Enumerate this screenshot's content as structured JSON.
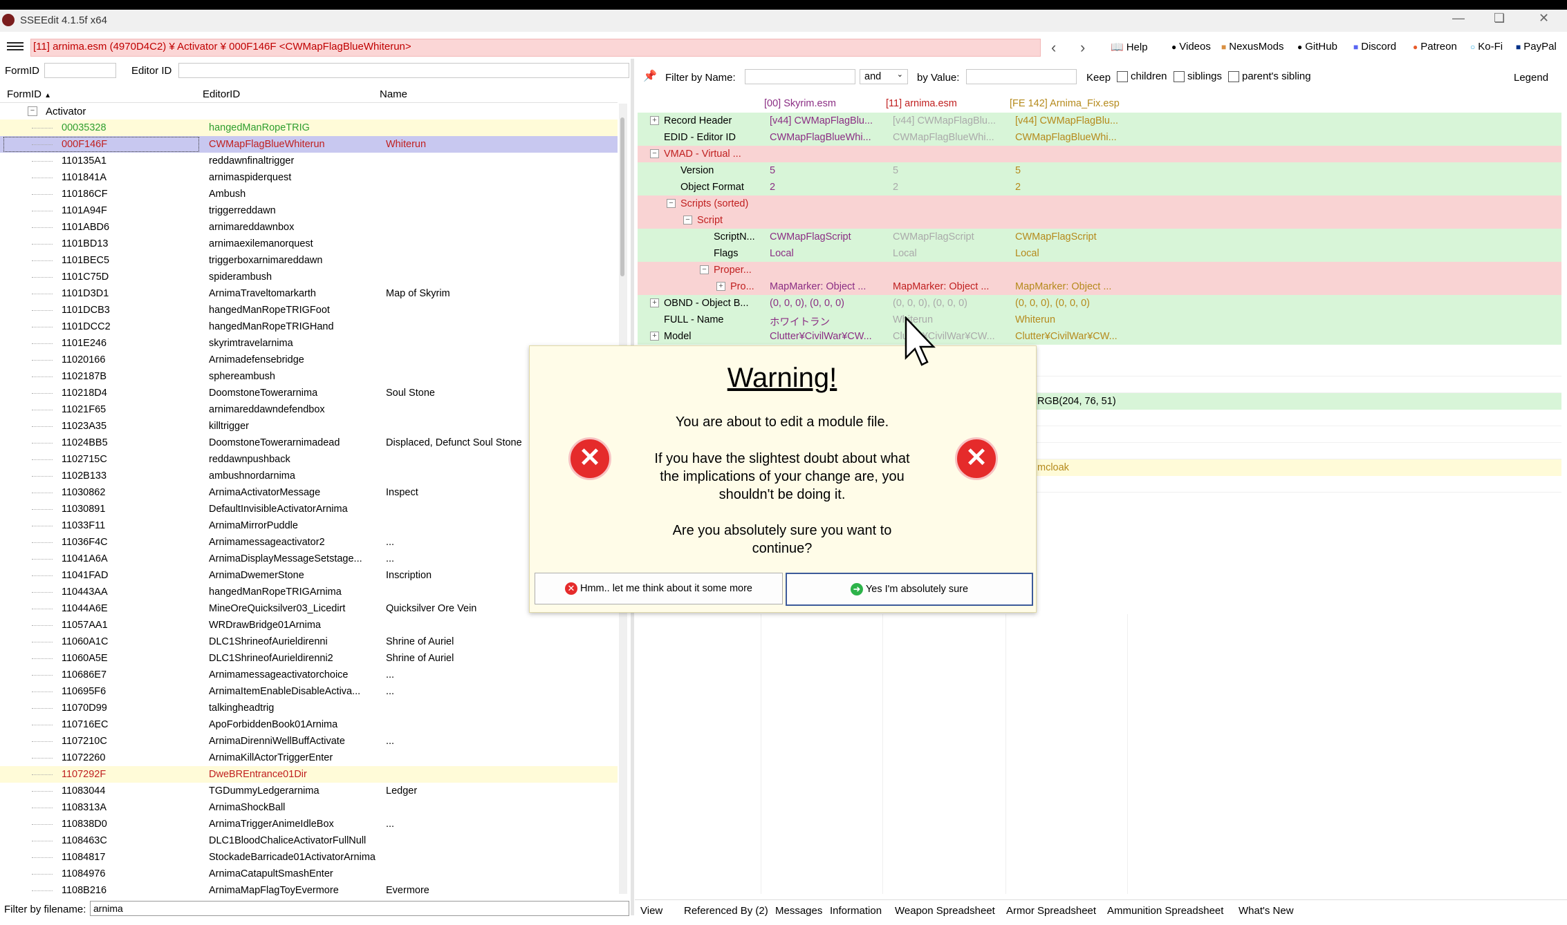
{
  "window": {
    "title": "SSEEdit 4.1.5f x64",
    "path": "[11] arnima.esm (4970D4C2) ¥ Activator ¥ 000F146F <CWMapFlagBlueWhiterun>"
  },
  "toplinks": [
    {
      "label": "Help",
      "icon": "book-icon"
    },
    {
      "label": "Videos",
      "icon": "video-icon"
    },
    {
      "label": "NexusMods",
      "icon": "nexus-icon"
    },
    {
      "label": "GitHub",
      "icon": "github-icon"
    },
    {
      "label": "Discord",
      "icon": "discord-icon"
    },
    {
      "label": "Patreon",
      "icon": "patreon-icon"
    },
    {
      "label": "Ko-Fi",
      "icon": "kofi-icon"
    },
    {
      "label": "PayPal",
      "icon": "paypal-icon"
    }
  ],
  "left": {
    "formid_label": "FormID",
    "editorid_label": "Editor ID",
    "columns": {
      "formid": "FormID",
      "editorid": "EditorID",
      "name": "Name"
    },
    "group": "Activator",
    "rows": [
      {
        "formid": "00035328",
        "editorid": "hangedManRopeTRIG",
        "name": "",
        "style": "green"
      },
      {
        "formid": "000F146F",
        "editorid": "CWMapFlagBlueWhiterun",
        "name": "Whiterun",
        "style": "selected"
      },
      {
        "formid": "110135A1",
        "editorid": "reddawnfinaltrigger",
        "name": ""
      },
      {
        "formid": "1101841A",
        "editorid": "arnimaspiderquest",
        "name": ""
      },
      {
        "formid": "110186CF",
        "editorid": "Ambush",
        "name": ""
      },
      {
        "formid": "1101A94F",
        "editorid": "triggerreddawn",
        "name": ""
      },
      {
        "formid": "1101ABD6",
        "editorid": "arnimareddawnbox",
        "name": ""
      },
      {
        "formid": "1101BD13",
        "editorid": "arnimaexilemanorquest",
        "name": ""
      },
      {
        "formid": "1101BEC5",
        "editorid": "triggerboxarnimareddawn",
        "name": ""
      },
      {
        "formid": "1101C75D",
        "editorid": "spiderambush",
        "name": ""
      },
      {
        "formid": "1101D3D1",
        "editorid": "ArnimaTraveltomarkarth",
        "name": "Map of Skyrim"
      },
      {
        "formid": "1101DCB3",
        "editorid": "hangedManRopeTRIGFoot",
        "name": ""
      },
      {
        "formid": "1101DCC2",
        "editorid": "hangedManRopeTRIGHand",
        "name": ""
      },
      {
        "formid": "1101E246",
        "editorid": "skyrimtravelarnima",
        "name": ""
      },
      {
        "formid": "11020166",
        "editorid": "Arnimadefensebridge",
        "name": ""
      },
      {
        "formid": "1102187B",
        "editorid": "sphereambush",
        "name": ""
      },
      {
        "formid": "110218D4",
        "editorid": "DoomstoneTowerarnima",
        "name": "Soul Stone"
      },
      {
        "formid": "11021F65",
        "editorid": "arnimareddawndefendbox",
        "name": ""
      },
      {
        "formid": "11023A35",
        "editorid": "killtrigger",
        "name": ""
      },
      {
        "formid": "11024BB5",
        "editorid": "DoomstoneTowerarnimadead",
        "name": "Displaced, Defunct Soul Stone"
      },
      {
        "formid": "1102715C",
        "editorid": "reddawnpushback",
        "name": ""
      },
      {
        "formid": "1102B133",
        "editorid": "ambushnordarnima",
        "name": ""
      },
      {
        "formid": "11030862",
        "editorid": "ArnimaActivatorMessage",
        "name": "Inspect"
      },
      {
        "formid": "11030891",
        "editorid": "DefaultInvisibleActivatorArnima",
        "name": ""
      },
      {
        "formid": "11033F11",
        "editorid": "ArnimaMirrorPuddle",
        "name": ""
      },
      {
        "formid": "11036F4C",
        "editorid": "Arnimamessageactivator2",
        "name": "..."
      },
      {
        "formid": "11041A6A",
        "editorid": "ArnimaDisplayMessageSetstage...",
        "name": "..."
      },
      {
        "formid": "11041FAD",
        "editorid": "ArnimaDwemerStone",
        "name": "Inscription"
      },
      {
        "formid": "110443AA",
        "editorid": "hangedManRopeTRIGArnima",
        "name": ""
      },
      {
        "formid": "11044A6E",
        "editorid": "MineOreQuicksilver03_Licedirt",
        "name": "Quicksilver Ore Vein"
      },
      {
        "formid": "11057AA1",
        "editorid": "WRDrawBridge01Arnima",
        "name": ""
      },
      {
        "formid": "11060A1C",
        "editorid": "DLC1ShrineofAurieldirenni",
        "name": "Shrine of Auriel"
      },
      {
        "formid": "11060A5E",
        "editorid": "DLC1ShrineofAurieldirenni2",
        "name": "Shrine of Auriel"
      },
      {
        "formid": "110686E7",
        "editorid": "Arnimamessageactivatorchoice",
        "name": "..."
      },
      {
        "formid": "110695F6",
        "editorid": "ArnimaItemEnableDisableActiva...",
        "name": "..."
      },
      {
        "formid": "11070D99",
        "editorid": "talkingheadtrig",
        "name": ""
      },
      {
        "formid": "110716EC",
        "editorid": "ApoForbiddenBook01Arnima",
        "name": ""
      },
      {
        "formid": "1107210C",
        "editorid": "ArnimaDirenniWellBuffActivate",
        "name": "..."
      },
      {
        "formid": "11072260",
        "editorid": "ArnimaKillActorTriggerEnter",
        "name": ""
      },
      {
        "formid": "1107292F",
        "editorid": "DweBREntrance01Dir",
        "name": "",
        "style": "yellowred"
      },
      {
        "formid": "11083044",
        "editorid": "TGDummyLedgerarnima",
        "name": "Ledger"
      },
      {
        "formid": "1108313A",
        "editorid": "ArnimaShockBall",
        "name": ""
      },
      {
        "formid": "110838D0",
        "editorid": "ArnimaTriggerAnimeIdleBox",
        "name": "..."
      },
      {
        "formid": "1108463C",
        "editorid": "DLC1BloodChaliceActivatorFullNull",
        "name": ""
      },
      {
        "formid": "11084817",
        "editorid": "StockadeBarricade01ActivatorArnima",
        "name": ""
      },
      {
        "formid": "11084976",
        "editorid": "ArnimaCatapultSmashEnter",
        "name": ""
      },
      {
        "formid": "1108B216",
        "editorid": "ArnimaMapFlagToyEvermore",
        "name": "Evermore"
      }
    ],
    "filter_label": "Filter by filename:",
    "filter_value": "arnima"
  },
  "right": {
    "filter_name_label": "Filter by Name:",
    "and_label": "and",
    "filter_value_label": "by Value:",
    "keep_label": "Keep",
    "children_label": "children",
    "siblings_label": "siblings",
    "parents_sibling_label": "parent's sibling",
    "legend_label": "Legend",
    "headers": [
      "[00] Skyrim.esm",
      "[11] arnima.esm",
      "[FE 142] Arnima_Fix.esp"
    ],
    "rows": [
      {
        "label": "Record Header",
        "indent": 0,
        "expander": "+",
        "vals": [
          "[v44] CWMapFlagBlu...",
          "[v44] CWMapFlagBlu...",
          "[v44] CWMapFlagBlu..."
        ],
        "style": "green"
      },
      {
        "label": "EDID - Editor ID",
        "indent": 0,
        "expander": "",
        "vals": [
          "CWMapFlagBlueWhi...",
          "CWMapFlagBlueWhi...",
          "CWMapFlagBlueWhi..."
        ],
        "style": "green"
      },
      {
        "label": "VMAD - Virtual ...",
        "indent": 0,
        "expander": "−",
        "vals": [
          "",
          "",
          ""
        ],
        "style": "red"
      },
      {
        "label": "Version",
        "indent": 1,
        "expander": "",
        "vals": [
          "5",
          "5",
          "5"
        ],
        "style": "green"
      },
      {
        "label": "Object Format",
        "indent": 1,
        "expander": "",
        "vals": [
          "2",
          "2",
          "2"
        ],
        "style": "green"
      },
      {
        "label": "Scripts (sorted)",
        "indent": 1,
        "expander": "−",
        "vals": [
          "",
          "",
          ""
        ],
        "style": "red"
      },
      {
        "label": "Script",
        "indent": 2,
        "expander": "−",
        "vals": [
          "",
          "",
          ""
        ],
        "style": "red"
      },
      {
        "label": "ScriptN...",
        "indent": 3,
        "expander": "",
        "vals": [
          "CWMapFlagScript",
          "CWMapFlagScript",
          "CWMapFlagScript"
        ],
        "style": "green"
      },
      {
        "label": "Flags",
        "indent": 3,
        "expander": "",
        "vals": [
          "Local",
          "Local",
          "Local"
        ],
        "style": "green"
      },
      {
        "label": "Proper...",
        "indent": 3,
        "expander": "−",
        "vals": [
          "",
          "",
          ""
        ],
        "style": "red"
      },
      {
        "label": "Pro...",
        "indent": 4,
        "expander": "+",
        "vals": [
          "MapMarker: Object ...",
          "MapMarker: Object ...",
          "MapMarker: Object ..."
        ],
        "style": "red"
      },
      {
        "label": "OBND - Object B...",
        "indent": 0,
        "expander": "+",
        "vals": [
          "(0, 0, 0), (0, 0, 0)",
          "(0, 0, 0), (0, 0, 0)",
          "(0, 0, 0), (0, 0, 0)"
        ],
        "style": "green"
      },
      {
        "label": "FULL - Name",
        "indent": 0,
        "expander": "",
        "vals": [
          "ホワイトラン",
          "Whiterun",
          "Whiterun"
        ],
        "style": "green"
      },
      {
        "label": "Model",
        "indent": 0,
        "expander": "+",
        "vals": [
          "Clutter¥CivilWar¥CW...",
          "Clutter¥CivilWar¥CW...",
          "Clutter¥CivilWar¥CW..."
        ],
        "style": "green"
      }
    ],
    "partial": {
      "rgb": "RGB(204, 76, 51)",
      "cloak": "mcloak"
    }
  },
  "dialog": {
    "title": "Warning!",
    "line1": "You are about to edit a module file.",
    "line2": "If you have the slightest doubt about what the implications of your change are, you shouldn't be doing it.",
    "line3": "Are you absolutely sure you want to continue?",
    "cancel": "Hmm.. let me think about it some more",
    "confirm": "Yes I'm absolutely sure"
  },
  "tabs": [
    "View",
    "Referenced By (2)",
    "Messages",
    "Information",
    "Weapon Spreadsheet",
    "Armor Spreadsheet",
    "Ammunition Spreadsheet",
    "What's New"
  ],
  "colors": {
    "green_row": "#d8f5d8",
    "red_row": "#f9d3d3",
    "selection": "#c8c8f0",
    "path_bg": "#fbd6d6",
    "warning_bg": "#fffce8"
  }
}
